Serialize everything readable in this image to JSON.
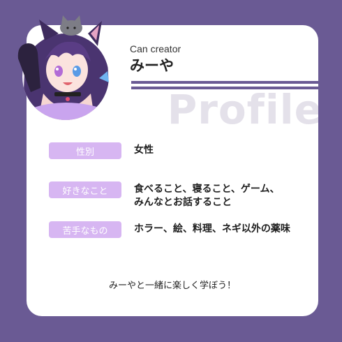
{
  "header": {
    "subtitle": "Can creator",
    "name": "みーや",
    "watermark": "Profile"
  },
  "avatar": {
    "description": "anime-style character portrait with purple hair, cat ears and a grey cat on her head"
  },
  "profile": [
    {
      "label": "性別",
      "lines": [
        "女性"
      ]
    },
    {
      "label": "好きなこと",
      "lines": [
        "食べること、寝ること、ゲーム、",
        "みんなとお話すること"
      ]
    },
    {
      "label": "苦手なもの",
      "lines": [
        "ホラー、絵、料理、ネギ以外の薬味"
      ]
    }
  ],
  "closing": "みーやと一緒に楽しく学ぼう！",
  "colors": {
    "background": "#6a5a94",
    "card": "#ffffff",
    "pill": "#d7b6f2",
    "rule": "#6a5a94",
    "watermark": "#e4e1ea"
  }
}
